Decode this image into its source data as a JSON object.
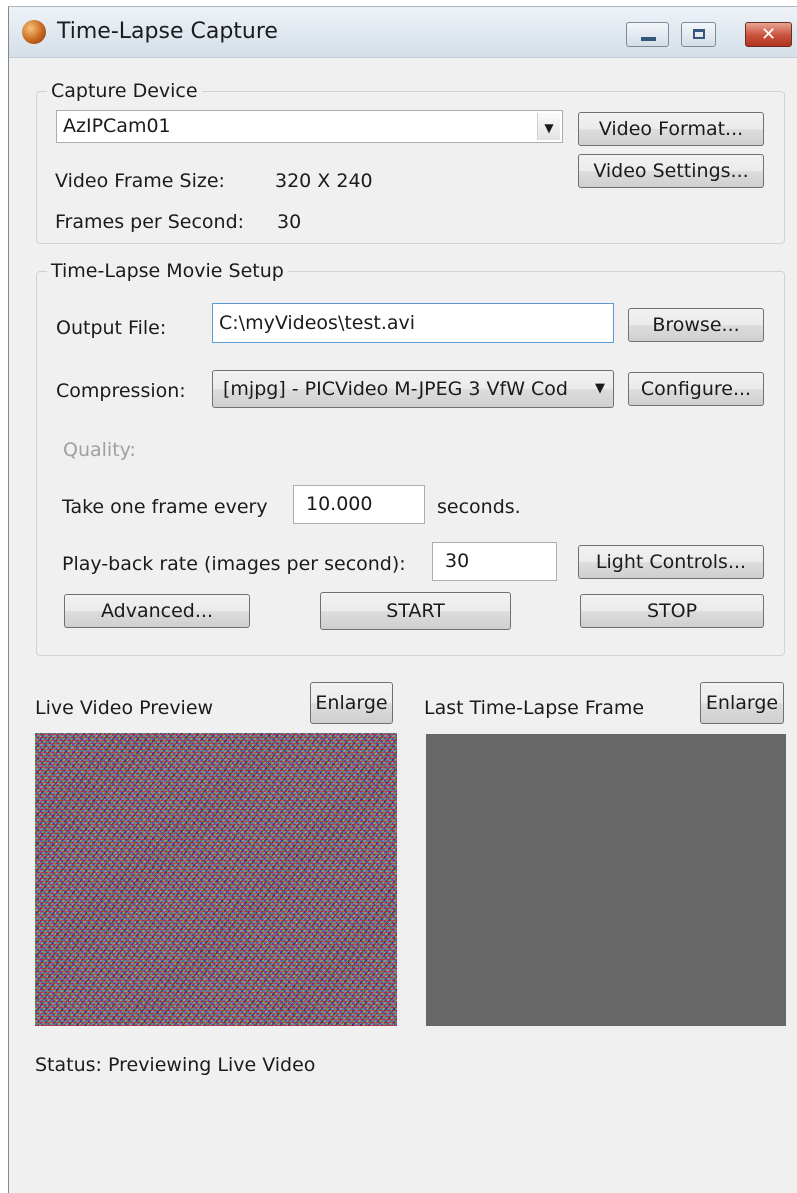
{
  "window": {
    "title": "Time-Lapse Capture"
  },
  "icons": {
    "app": "camera-app-icon",
    "minimize": "minimize-icon",
    "maximize": "maximize-icon",
    "close": "close-icon",
    "dropdown": "chevron-down-icon"
  },
  "capture_device": {
    "group_label": "Capture Device",
    "device_selected": "AzIPCam01",
    "video_format_button": "Video Format...",
    "video_settings_button": "Video Settings...",
    "frame_size_label": "Video Frame Size:",
    "frame_size_value": "320 X 240",
    "fps_label": "Frames per Second:",
    "fps_value": "30"
  },
  "movie_setup": {
    "group_label": "Time-Lapse Movie Setup",
    "output_file_label": "Output File:",
    "output_file_value": "C:\\myVideos\\test.avi",
    "browse_button": "Browse...",
    "compression_label": "Compression:",
    "compression_selected": "[mjpg] - PICVideo M-JPEG 3 VfW Cod",
    "configure_button": "Configure...",
    "quality_label": "Quality:",
    "interval_prefix": "Take one frame every",
    "interval_value": "10.000",
    "interval_suffix": "seconds.",
    "playback_label": "Play-back rate (images per second):",
    "playback_value": "30",
    "light_controls_button": "Light Controls...",
    "advanced_button": "Advanced...",
    "start_button": "START",
    "stop_button": "STOP"
  },
  "previews": {
    "live_label": "Live Video Preview",
    "live_enlarge": "Enlarge",
    "last_label": "Last Time-Lapse Frame",
    "last_enlarge": "Enlarge"
  },
  "status": {
    "text": "Status: Previewing Live Video"
  },
  "colors": {
    "window_bg": "#f0f0f0",
    "last_frame_bg": "#676767",
    "close_button": "#c8513b"
  }
}
